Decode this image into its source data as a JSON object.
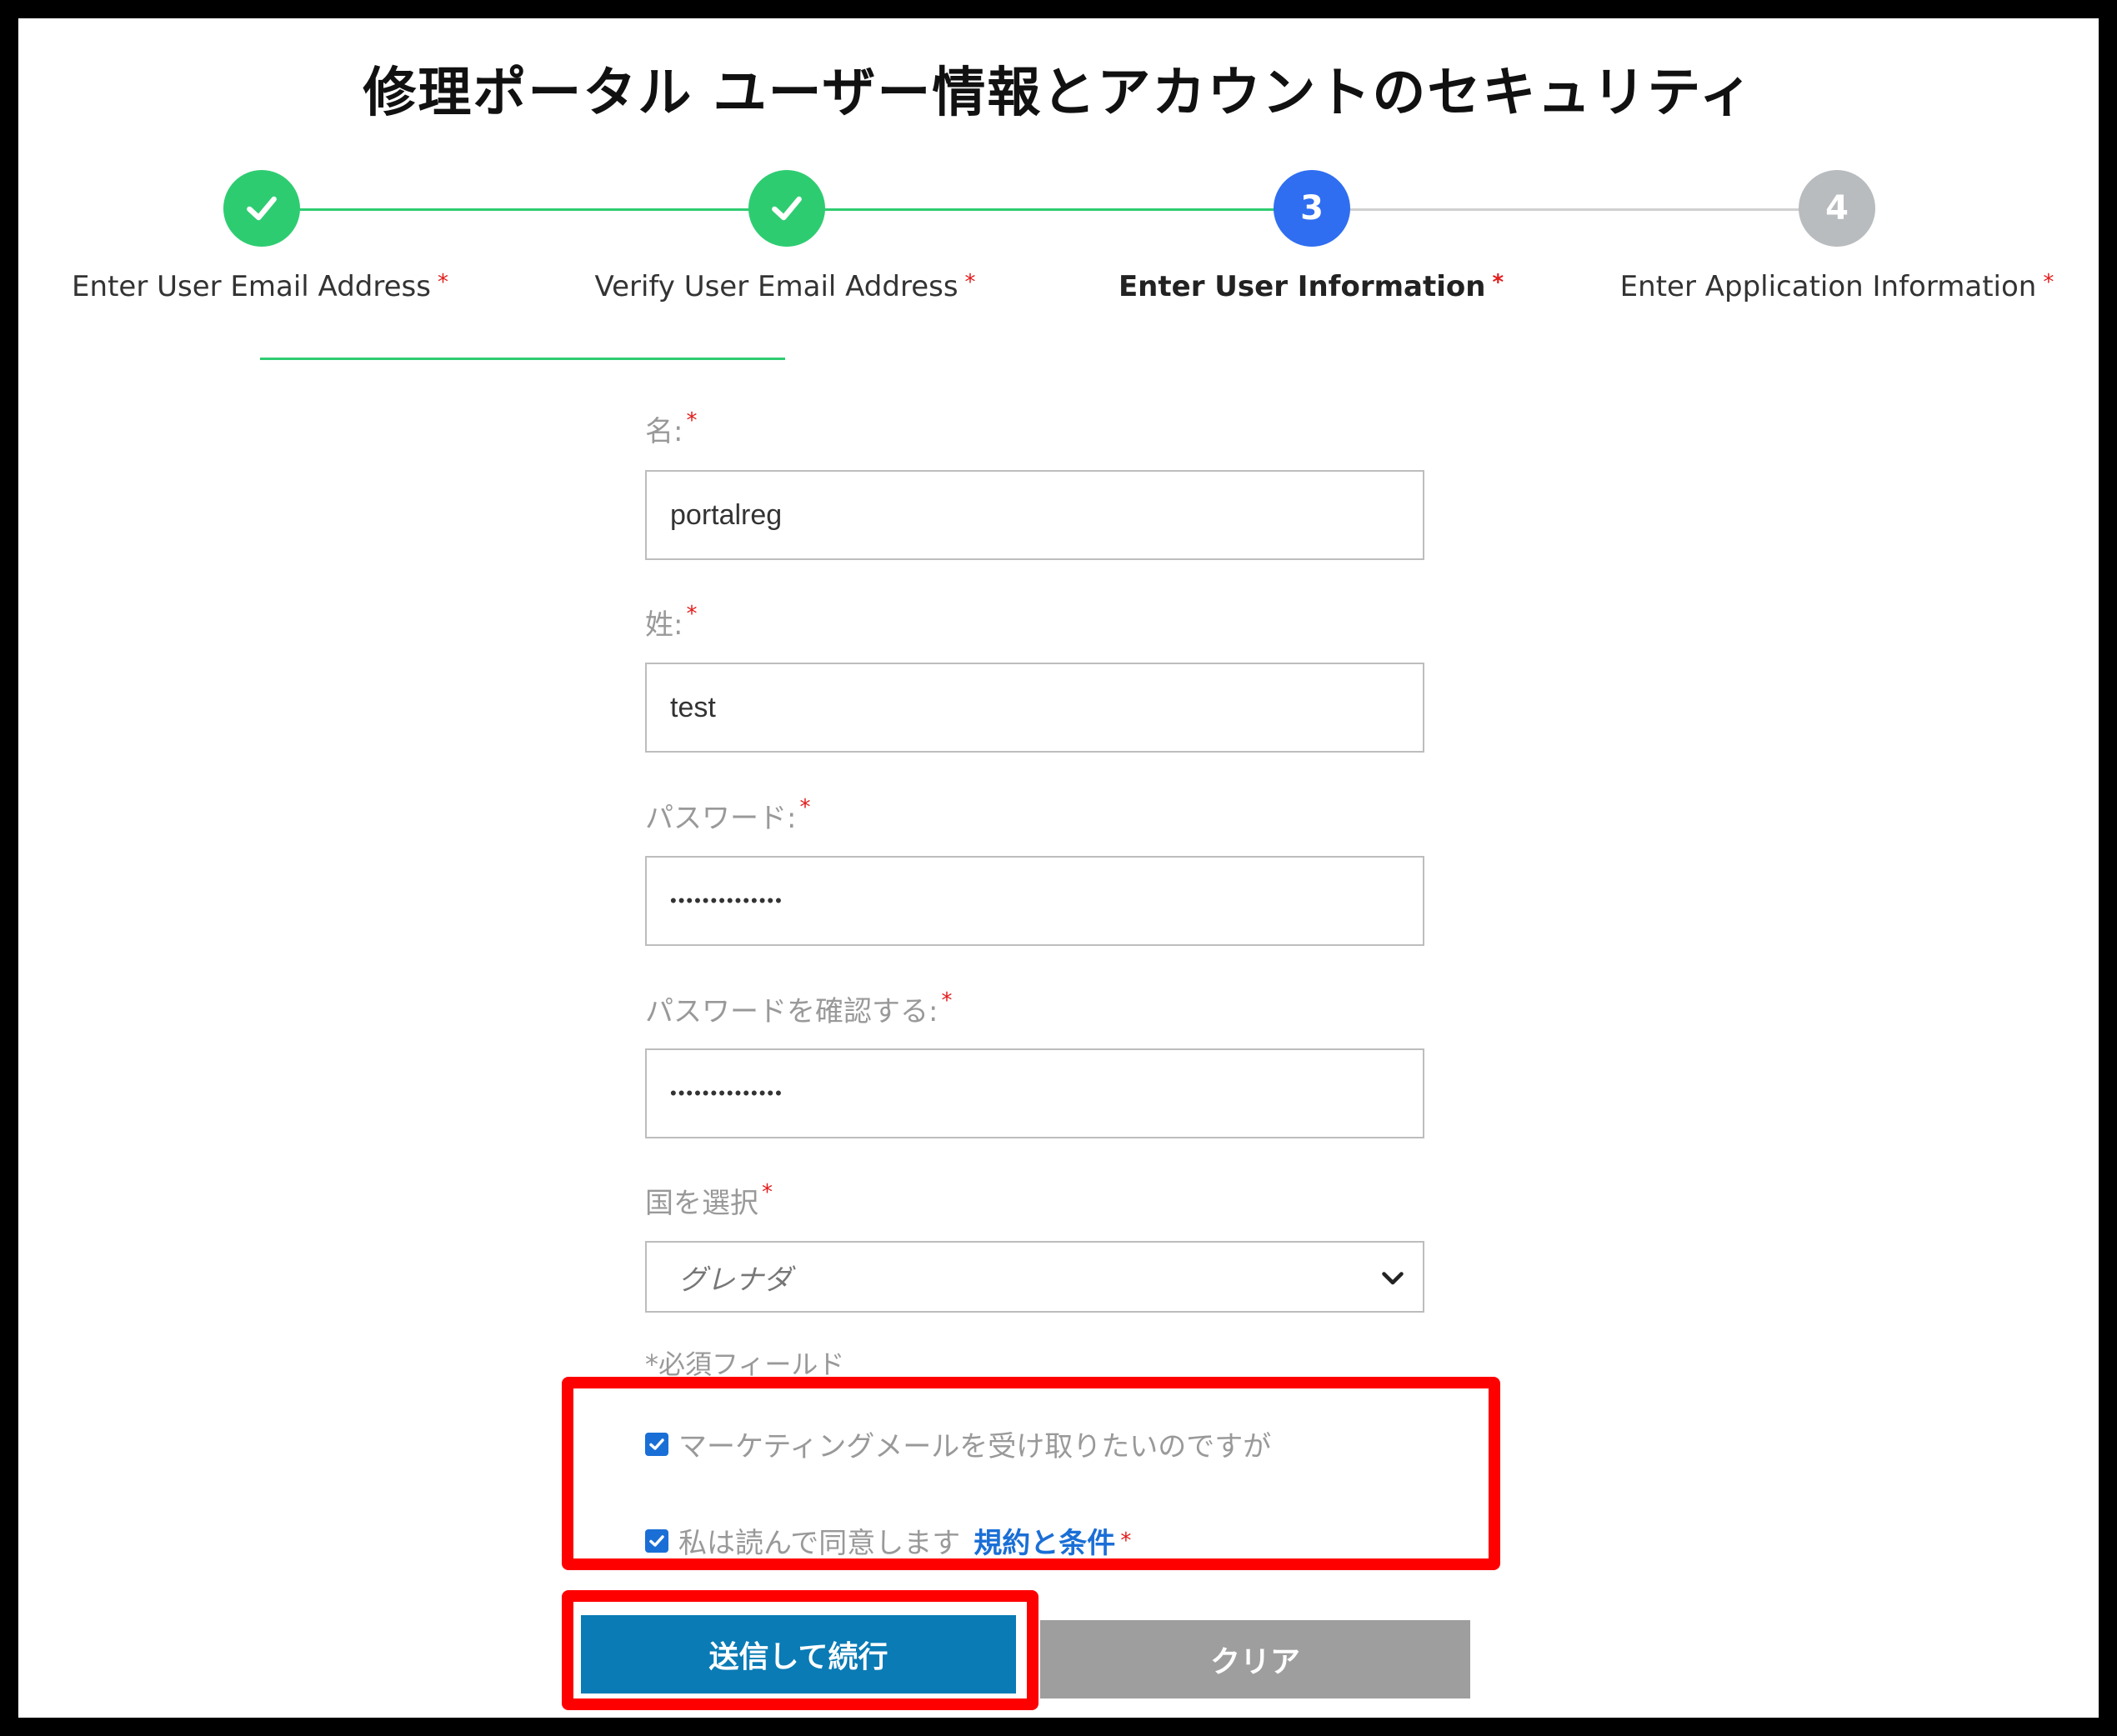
{
  "page_title": "修理ポータル ユーザー情報とアカウントのセキュリティ",
  "stepper": {
    "steps": [
      {
        "number": "✓",
        "label": "Enter User Email Address",
        "status": "complete"
      },
      {
        "number": "✓",
        "label": "Verify User Email Address",
        "status": "complete"
      },
      {
        "number": "3",
        "label": "Enter User Information",
        "status": "current"
      },
      {
        "number": "4",
        "label": "Enter Application Information",
        "status": "pending"
      }
    ],
    "required_mark": "*"
  },
  "form": {
    "first_name": {
      "label": "名:",
      "value": "portalreg"
    },
    "last_name": {
      "label": "姓:",
      "value": "test"
    },
    "password": {
      "label": "パスワード:",
      "value": "••••••••••••••"
    },
    "confirm_password": {
      "label": "パスワードを確認する:",
      "value": "••••••••••••••"
    },
    "country": {
      "label": "国を選択",
      "value": "グレナダ"
    },
    "required_note": "*必須フィールド",
    "marketing_checkbox": {
      "label": "マーケティングメールを受け取りたいのですが",
      "checked": true
    },
    "terms_checkbox": {
      "label": "私は読んで同意します",
      "link": "規約と条件",
      "checked": true
    },
    "submit_label": "送信して続行",
    "clear_label": "クリア"
  },
  "colors": {
    "complete": "#2ecc71",
    "current": "#2f6ef0",
    "pending": "#b9bcbf",
    "primary_button": "#0a7bb5",
    "clear_button": "#9e9e9e",
    "highlight": "#ff0000",
    "required": "#e31b1b"
  }
}
